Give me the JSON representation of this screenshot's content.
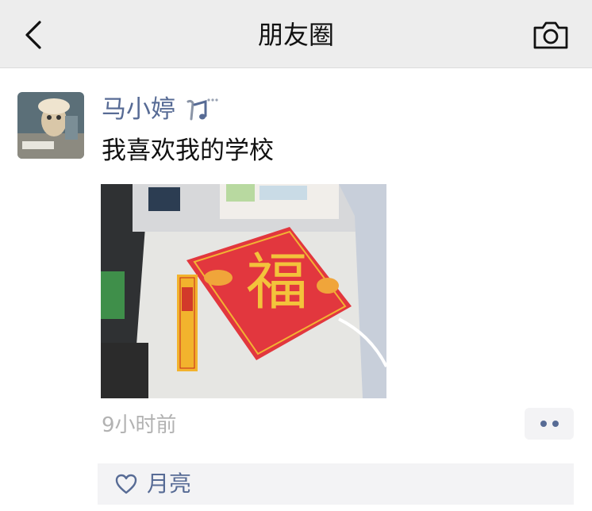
{
  "nav": {
    "title": "朋友圈",
    "back_icon": "chevron-left-icon",
    "camera_icon": "camera-icon"
  },
  "post": {
    "author": "马小婷",
    "status_icon": "music-note-status-icon",
    "text": "我喜欢我的学校",
    "photo_caption_char": "福",
    "time": "9小时前",
    "more_icon": "more-dots-icon",
    "likes": {
      "heart_icon": "heart-icon",
      "names": "月亮"
    }
  },
  "colors": {
    "nav_bg": "#ededed",
    "name_blue": "#576b95",
    "time_gray": "#b2b2b2",
    "like_bg": "#f3f3f5"
  }
}
